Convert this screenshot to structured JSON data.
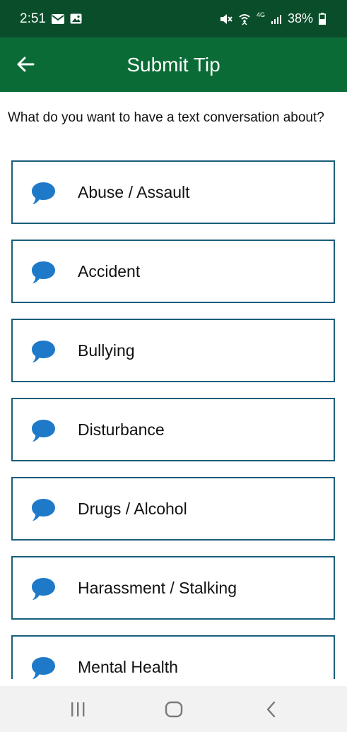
{
  "status_bar": {
    "time": "2:51",
    "network_label": "4G",
    "battery_percent": "38%",
    "icons": [
      "mail-icon",
      "image-icon",
      "mute-icon",
      "wifi-calling-icon",
      "signal-icon",
      "battery-icon"
    ]
  },
  "app_bar": {
    "title": "Submit Tip",
    "back_icon": "arrow-left-icon"
  },
  "prompt": "What do you want to have a text conversation about?",
  "topics": [
    {
      "label": "Abuse / Assault",
      "icon": "chat-bubble-icon"
    },
    {
      "label": "Accident",
      "icon": "chat-bubble-icon"
    },
    {
      "label": "Bullying",
      "icon": "chat-bubble-icon"
    },
    {
      "label": "Disturbance",
      "icon": "chat-bubble-icon"
    },
    {
      "label": "Drugs / Alcohol",
      "icon": "chat-bubble-icon"
    },
    {
      "label": "Harassment / Stalking",
      "icon": "chat-bubble-icon"
    },
    {
      "label": "Mental Health",
      "icon": "chat-bubble-icon"
    }
  ],
  "colors": {
    "status_bar": "#0a4d2b",
    "app_bar": "#0b6b36",
    "item_border": "#1a5e7a",
    "chat_icon": "#1e7ac9",
    "nav_bar": "#f2f2f2"
  },
  "nav_bar": {
    "buttons": [
      "recent-apps-icon",
      "home-icon",
      "back-icon"
    ]
  }
}
